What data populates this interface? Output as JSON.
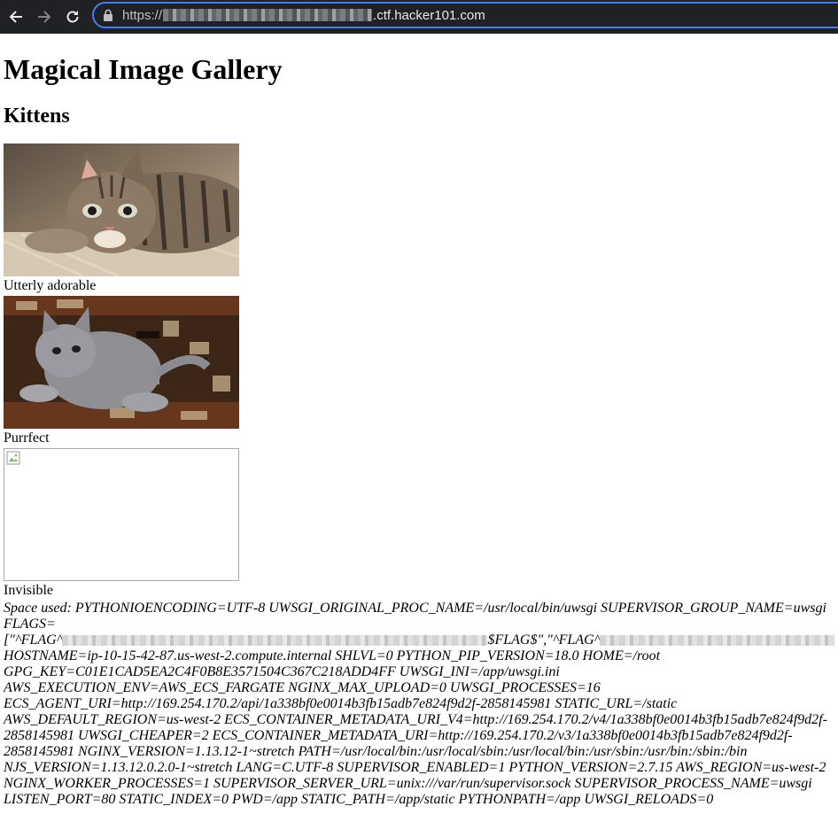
{
  "browser": {
    "url_scheme": "https://",
    "url_host_suffix": ".ctf.hacker101.com"
  },
  "page": {
    "title": "Magical Image Gallery",
    "section": "Kittens"
  },
  "gallery": [
    {
      "caption": "Utterly adorable"
    },
    {
      "caption": "Purrfect"
    },
    {
      "caption": "Invisible"
    }
  ],
  "env": {
    "line1": "Space used: PYTHONIOENCODING=UTF-8 UWSGI_ORIGINAL_PROC_NAME=/usr/local/bin/uwsgi SUPERVISOR_GROUP_NAME=uwsgi",
    "line2": "FLAGS=",
    "flags_prefix": "[\"^FLAG^",
    "flags_mid": "$FLAG$\",\"^FLAG^",
    "line4": "HOSTNAME=ip-10-15-42-87.us-west-2.compute.internal SHLVL=0 PYTHON_PIP_VERSION=18.0 HOME=/root",
    "line5": "GPG_KEY=C01E1CAD5EA2C4F0B8E3571504C367C218ADD4FF UWSGI_INI=/app/uwsgi.ini",
    "line6": "AWS_EXECUTION_ENV=AWS_ECS_FARGATE NGINX_MAX_UPLOAD=0 UWSGI_PROCESSES=16",
    "line7": "ECS_AGENT_URI=http://169.254.170.2/api/1a338bf0e0014b3fb15adb7e824f9d2f-2858145981 STATIC_URL=/static",
    "line8": "AWS_DEFAULT_REGION=us-west-2 ECS_CONTAINER_METADATA_URI_V4=http://169.254.170.2/v4/1a338bf0e0014b3fb15adb7e824f9d2f-",
    "line9": "2858145981 UWSGI_CHEAPER=2 ECS_CONTAINER_METADATA_URI=http://169.254.170.2/v3/1a338bf0e0014b3fb15adb7e824f9d2f-",
    "line10": "2858145981 NGINX_VERSION=1.13.12-1~stretch PATH=/usr/local/bin:/usr/local/sbin:/usr/local/bin:/usr/sbin:/usr/bin:/sbin:/bin",
    "line11": "NJS_VERSION=1.13.12.0.2.0-1~stretch LANG=C.UTF-8 SUPERVISOR_ENABLED=1 PYTHON_VERSION=2.7.15 AWS_REGION=us-west-2",
    "line12": "NGINX_WORKER_PROCESSES=1 SUPERVISOR_SERVER_URL=unix:///var/run/supervisor.sock SUPERVISOR_PROCESS_NAME=uwsgi",
    "line13": "LISTEN_PORT=80 STATIC_INDEX=0 PWD=/app STATIC_PATH=/app/static PYTHONPATH=/app UWSGI_RELOADS=0"
  }
}
